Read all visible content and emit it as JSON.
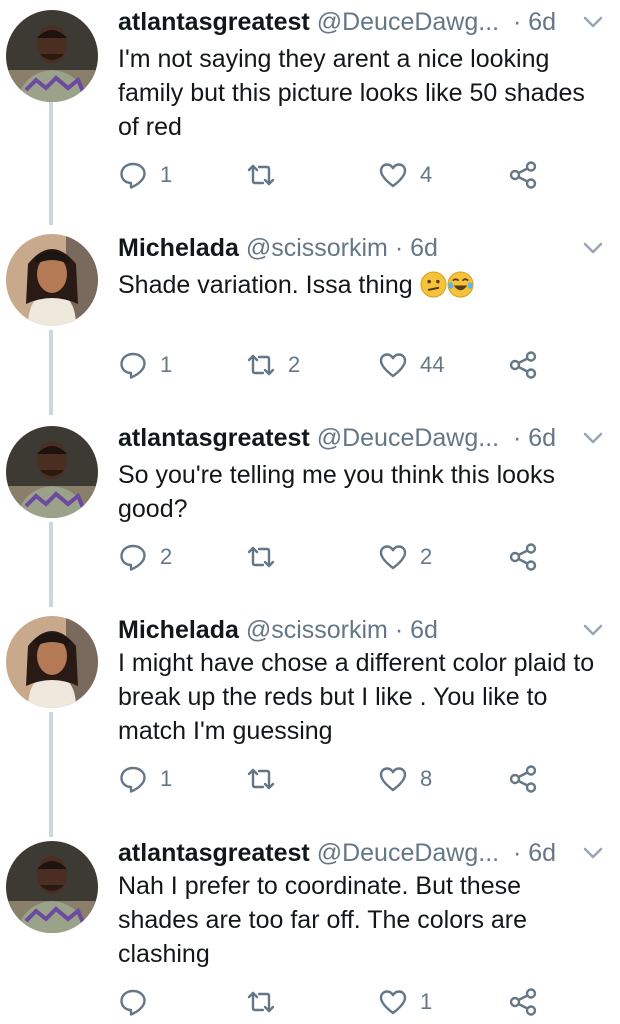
{
  "tweets": [
    {
      "name": "atlantasgreatest",
      "handle": "@DeuceDawg...",
      "time": "· 6d",
      "text": "I'm not saying they arent a nice looking family but this picture looks like 50 shades of red",
      "reply_count": "1",
      "retweet_count": "",
      "like_count": "4"
    },
    {
      "name": "Michelada",
      "handle": "@scissorkim",
      "time": "· 6d",
      "text": "Shade variation. Issa thing",
      "emojis": [
        "confused-face-emoji",
        "tears-of-joy-emoji"
      ],
      "reply_count": "1",
      "retweet_count": "2",
      "like_count": "44"
    },
    {
      "name": "atlantasgreatest",
      "handle": "@DeuceDawg...",
      "time": "· 6d",
      "text": "So you're telling me you think this looks good?",
      "reply_count": "2",
      "retweet_count": "",
      "like_count": "2"
    },
    {
      "name": "Michelada",
      "handle": "@scissorkim",
      "time": "· 6d",
      "text": "I might have chose a different color plaid to break up the reds but I like . You like to match I'm guessing",
      "reply_count": "1",
      "retweet_count": "",
      "like_count": "8"
    },
    {
      "name": "atlantasgreatest",
      "handle": "@DeuceDawg...",
      "time": "· 6d",
      "text": "Nah I prefer to coordinate. But these shades are too far off. The colors are clashing",
      "reply_count": "",
      "retweet_count": "",
      "like_count": "1"
    }
  ],
  "colors": {
    "text": "#14171a",
    "secondary": "#657786",
    "thread_line": "#ccd6dd",
    "icon": "#657786"
  }
}
